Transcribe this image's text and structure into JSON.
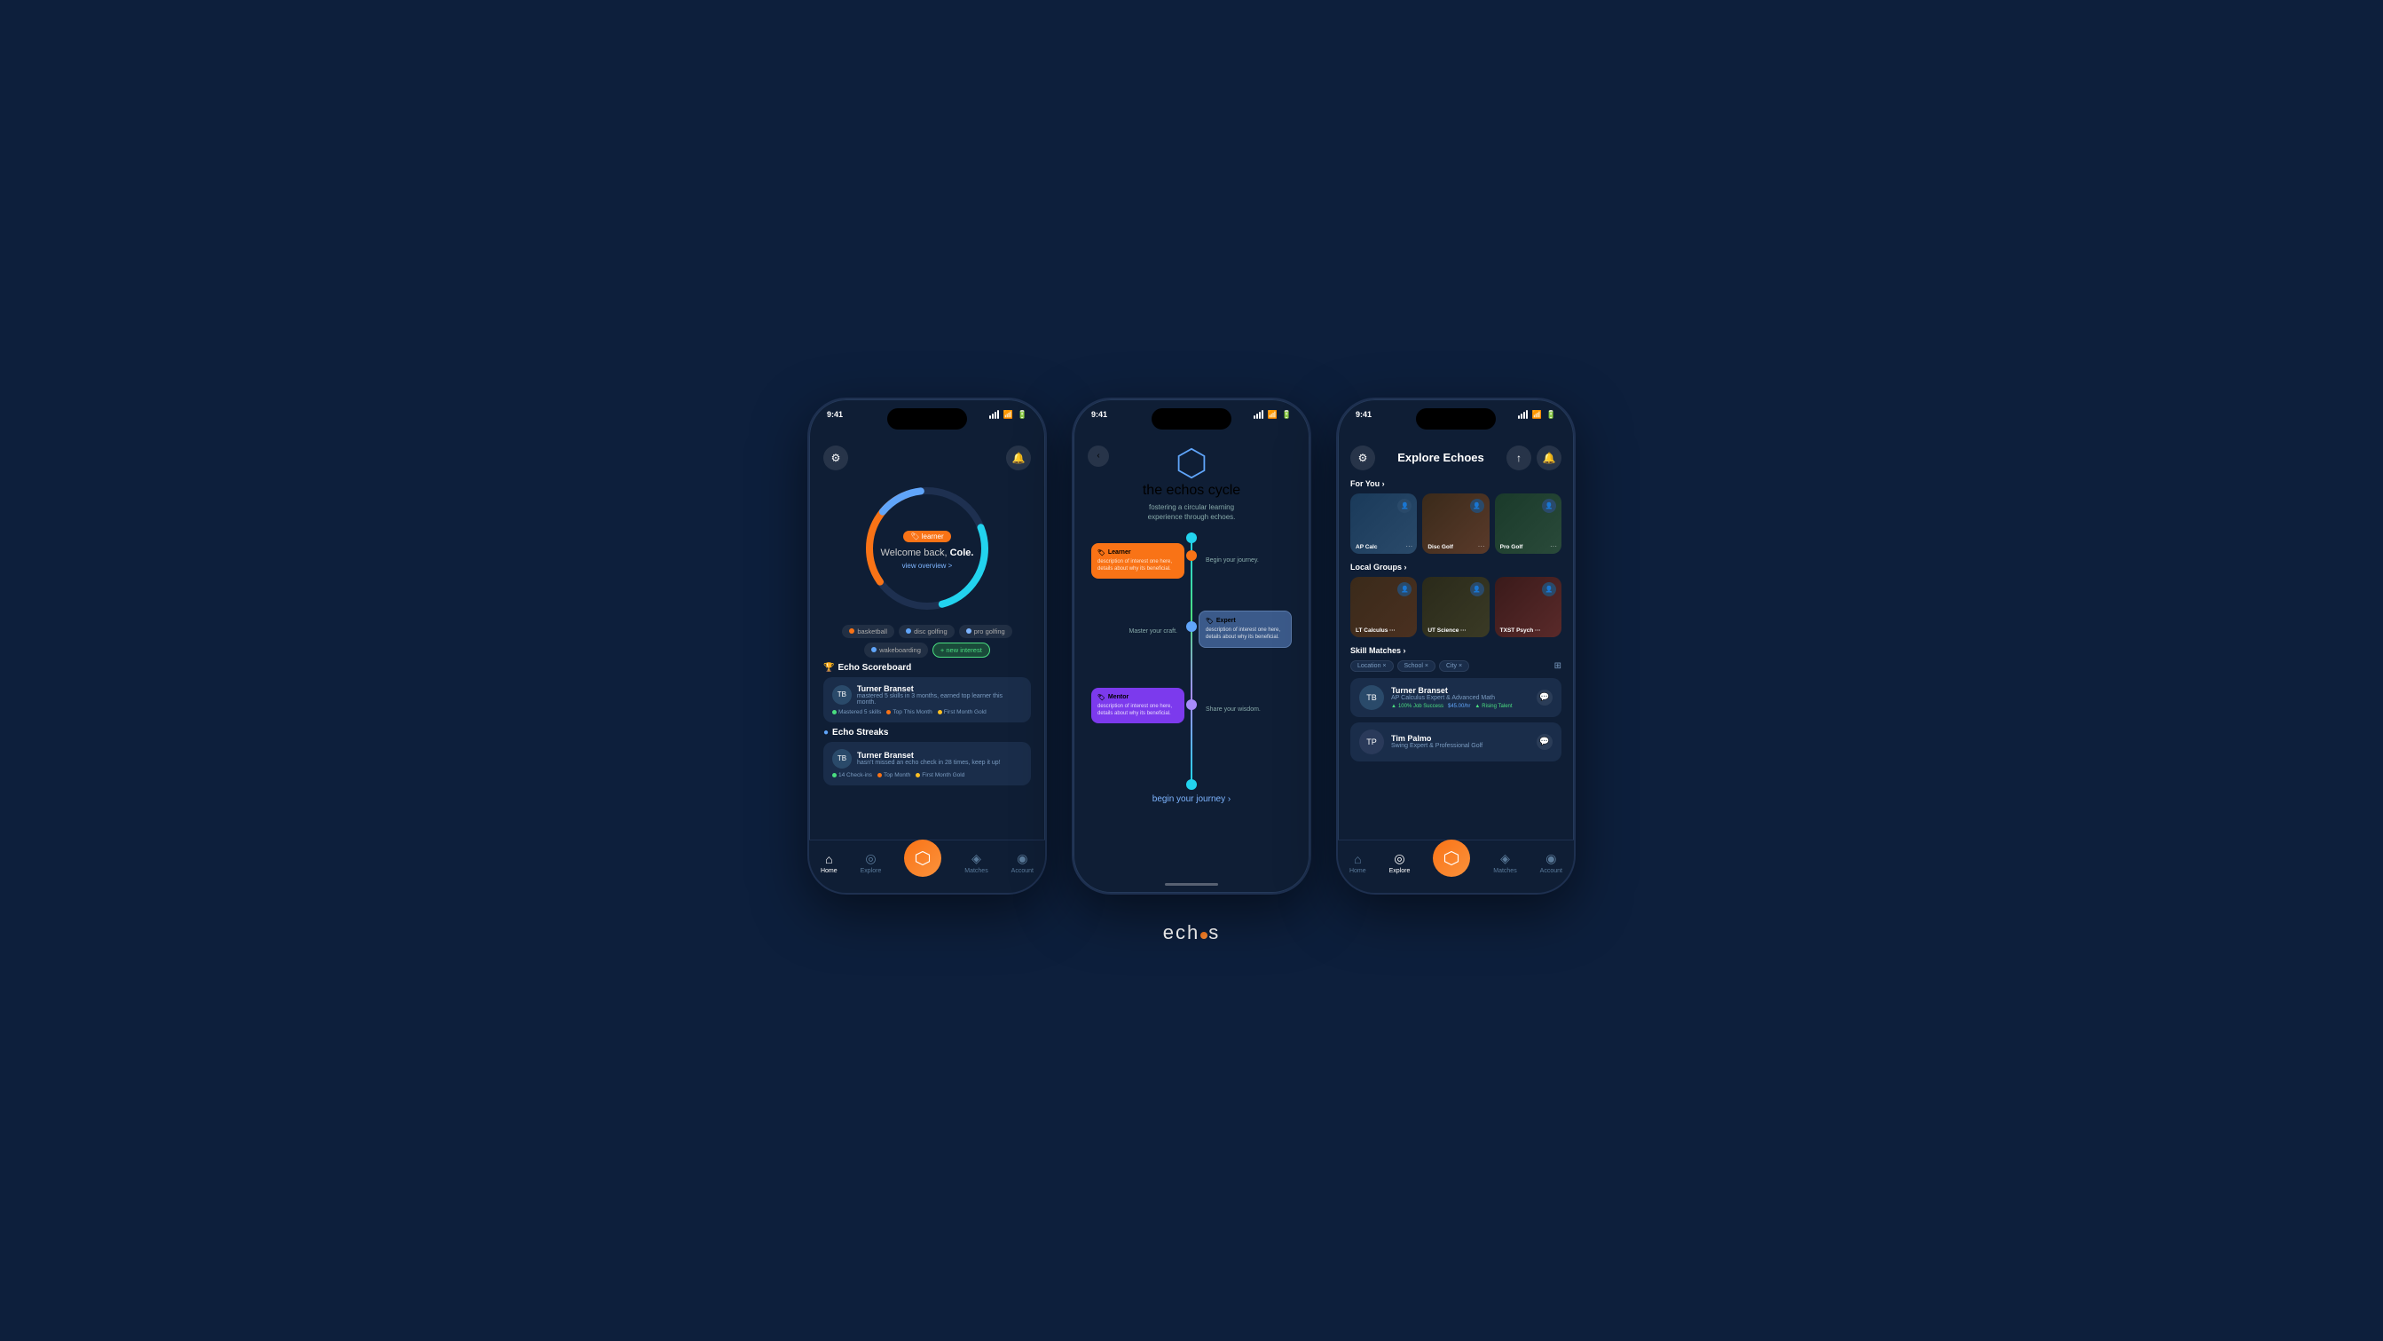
{
  "brand": {
    "name_prefix": "ech",
    "name_suffix": "s",
    "tagline": "echos"
  },
  "status_bar": {
    "time": "9:41",
    "signal": "●●●●",
    "wifi": "wifi",
    "battery": "battery"
  },
  "phone1": {
    "title": "Home",
    "settings_icon": "⚙",
    "bell_icon": "🔔",
    "learner_badge": "🏷 learner",
    "welcome_text": "Welcome back,",
    "user_name": "Cole.",
    "view_overview": "view overview >",
    "interests": [
      {
        "label": "basketball",
        "color": "#f97316",
        "active": false
      },
      {
        "label": "disc golfing",
        "color": "#60a5fa",
        "active": false
      },
      {
        "label": "pro golfing",
        "color": "#7eb5ff",
        "active": false
      },
      {
        "label": "wakeboarding",
        "color": "#60a5fa",
        "active": false
      },
      {
        "label": "new interest",
        "color": "#4ade80",
        "active": true
      }
    ],
    "echo_scoreboard_title": "Echo Scoreboard",
    "scoreboard_trophy": "🏆",
    "scoreboard_user": {
      "name": "Turner Branset",
      "description": "mastered 5 skills in 3 months, earned top learner this month.",
      "badge1": "Mastered 5 skills",
      "badge2": "Top This Month",
      "badge3": "First Month Gold"
    },
    "echo_streaks_title": "Echo Streaks",
    "streaks_icon": "●",
    "streak_user": {
      "name": "Turner Branset",
      "description": "hasn't missed an echo check in 28 times, keep it up!",
      "badge1": "14 Check-ins",
      "badge2": "Top Month",
      "badge3": "First Month Gold"
    },
    "nav": [
      {
        "label": "Home",
        "icon": "⌂",
        "active": true
      },
      {
        "label": "Explore",
        "icon": "◎",
        "active": false
      },
      {
        "label": "Matches",
        "icon": "◈",
        "active": false
      },
      {
        "label": "Account",
        "icon": "◉",
        "active": false
      }
    ],
    "center_btn_icon": "◆"
  },
  "phone2": {
    "title": "The Echos Cycle",
    "back_icon": "‹",
    "hex_icon": "⬡",
    "main_title": "the echos cycle",
    "subtitle": "fostering a circular learning\nexperience through echoes.",
    "journey": [
      {
        "role": "Learner",
        "icon": "🏷",
        "description": "description of interest one here, details about why its beneficial.",
        "side": "left",
        "color": "#f97316",
        "label": ""
      },
      {
        "role": "Expert",
        "icon": "🏷",
        "description": "description of interest one here, details about why its beneficial.",
        "side": "right",
        "label": "Master your craft."
      },
      {
        "role": "Mentor",
        "icon": "🏷",
        "description": "description of interest one here, details about why its beneficial.",
        "side": "left",
        "label": ""
      }
    ],
    "begin_text": "Begin your journey.",
    "master_text": "Master your craft.",
    "share_text": "Share your wisdom.",
    "begin_cta": "begin your journey ›"
  },
  "phone3": {
    "title": "Explore Echoes",
    "settings_icon": "⚙",
    "up_icon": "↑",
    "bell_icon": "🔔",
    "for_you_label": "For You ›",
    "for_you_cards": [
      {
        "label": "AP Calc",
        "type": "ap"
      },
      {
        "label": "Disc Golf",
        "type": "disc"
      },
      {
        "label": "Pro Golf",
        "type": "pro"
      }
    ],
    "local_groups_label": "Local Groups ›",
    "local_groups_cards": [
      {
        "label": "LT Calculus ···",
        "type": "lt"
      },
      {
        "label": "UT Science ···",
        "type": "ut"
      },
      {
        "label": "TXST Psych ···",
        "type": "txst"
      }
    ],
    "skill_matches_label": "Skill Matches ›",
    "filters": [
      {
        "label": "Location ×"
      },
      {
        "label": "School ×"
      },
      {
        "label": "City ×"
      }
    ],
    "skill_users": [
      {
        "name": "Turner Branset",
        "subtitle": "AP Calculus Expert & Advanced Math",
        "badge1": "100% Job Success",
        "badge2": "$45.00/hr",
        "badge3": "Rising Talent"
      },
      {
        "name": "Tim Palmo",
        "subtitle": "Swing Expert & Professional Golf",
        "badge1": "",
        "badge2": "",
        "badge3": ""
      }
    ],
    "nav": [
      {
        "label": "Home",
        "icon": "⌂",
        "active": false
      },
      {
        "label": "Explore",
        "icon": "◎",
        "active": true
      },
      {
        "label": "Matches",
        "icon": "◈",
        "active": false
      },
      {
        "label": "Account",
        "icon": "◉",
        "active": false
      }
    ],
    "center_btn_icon": "◆"
  }
}
